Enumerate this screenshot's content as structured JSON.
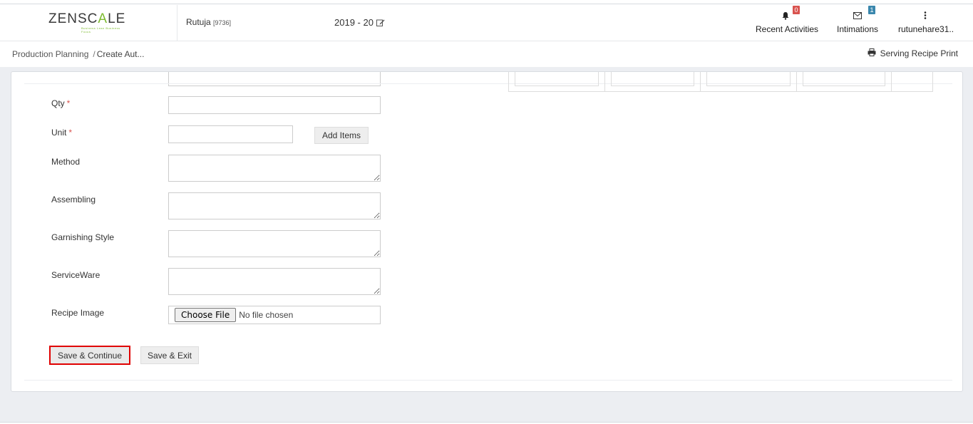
{
  "brand": {
    "logo_prefix": "ZENSC",
    "logo_accent": "A",
    "logo_suffix": "LE",
    "logo_tagline": "Business Lean Business Focus",
    "accent_color": "#7dbb2f"
  },
  "header": {
    "user_name": "Rutuja",
    "user_id": "[9736]",
    "fiscal_year": "2019 - 20",
    "nav": {
      "recent_activities": {
        "label": "Recent Activities",
        "count": "0",
        "icon": "bell-icon"
      },
      "intimations": {
        "label": "Intimations",
        "count": "1",
        "icon": "envelope-icon"
      },
      "user_menu": {
        "label": "rutunehare31..",
        "icon": "vertical-ellipsis-icon"
      }
    }
  },
  "breadcrumb": {
    "item1": "Production Planning",
    "separator": "/",
    "item2": "Create Aut..."
  },
  "actions": {
    "print_label": "Serving Recipe Print",
    "print_icon": "printer-icon"
  },
  "form": {
    "qty_label": "Qty",
    "unit_label": "Unit",
    "required_mark": "*",
    "add_items_label": "Add Items",
    "method_label": "Method",
    "assembling_label": "Assembling",
    "garnishing_label": "Garnishing Style",
    "serviceware_label": "ServiceWare",
    "recipe_image_label": "Recipe Image",
    "choose_file_label": "Choose File",
    "no_file_text": "No file chosen",
    "qty_value": "",
    "unit_value": ""
  },
  "buttons": {
    "save_continue": "Save & Continue",
    "save_exit": "Save & Exit"
  },
  "colors": {
    "required": "#d9534f",
    "badge_red": "#d9534f",
    "badge_blue": "#3a87ad",
    "highlight_border": "#e00000",
    "background": "#eceef2"
  }
}
